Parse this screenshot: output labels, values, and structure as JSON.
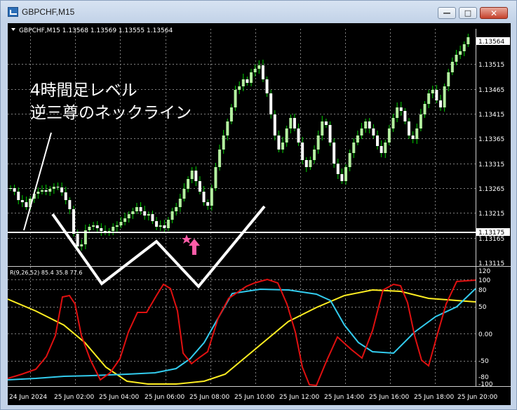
{
  "window": {
    "title": "GBPCHF,M15",
    "buttons": {
      "minimize": "—",
      "maximize": "□",
      "close": "✕"
    }
  },
  "chart": {
    "header": "GBPCHF,M15  1.13568 1.13569 1.13555 1.13564",
    "price_ticks": [
      "1.13515",
      "1.13465",
      "1.13415",
      "1.13365",
      "1.13315",
      "1.13265",
      "1.13215",
      "1.13165",
      "1.13115"
    ],
    "current_price_label": "1.13564",
    "line_price_label": "1.13175",
    "annotation_line1": "4時間足レベル",
    "annotation_line2": "逆三尊のネックライン",
    "colors": {
      "bull_candle": "#b4f0a0",
      "bear_candle": "#ffffff",
      "wick": "#00d000",
      "grid": "#7f7f7f",
      "neckline": "#ffffff",
      "marker": "#ff5ca8"
    },
    "indicator": {
      "label": "R(9,26,52) 85.4 35.8 77.6",
      "ticks": [
        "120",
        "100",
        "80",
        "50",
        "0.00",
        "-50",
        "-80",
        "-100"
      ],
      "colors": {
        "red": "#e01010",
        "cyan": "#33ccee",
        "yellow": "#ffee22"
      }
    },
    "time_labels": [
      "24 Jun 2024",
      "25 Jun 02:00",
      "25 Jun 04:00",
      "25 Jun 06:00",
      "25 Jun 08:00",
      "25 Jun 10:00",
      "25 Jun 12:00",
      "25 Jun 14:00",
      "25 Jun 16:00",
      "25 Jun 18:00",
      "25 Jun 20:00"
    ]
  }
}
